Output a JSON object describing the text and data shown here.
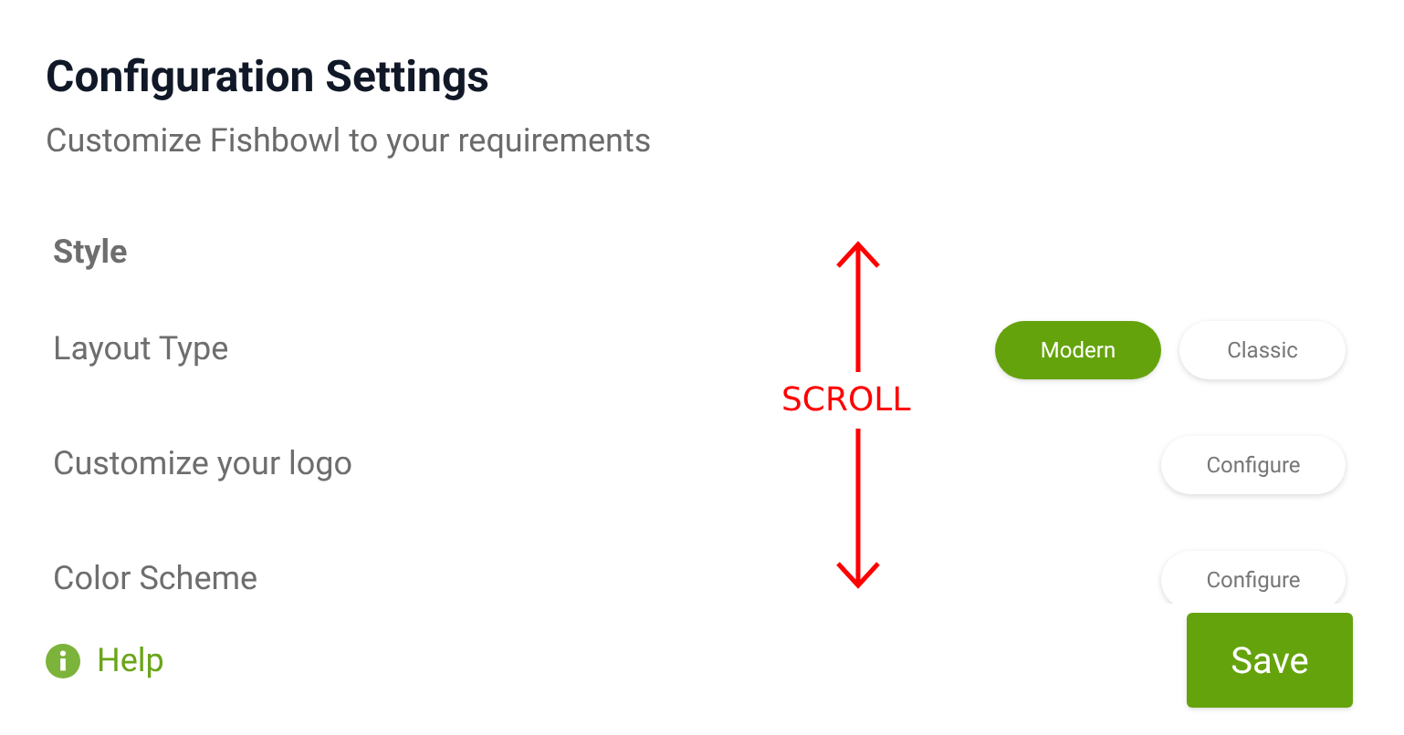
{
  "header": {
    "title": "Configuration Settings",
    "subtitle": "Customize Fishbowl to your requirements"
  },
  "section": {
    "title": "Style",
    "rows": [
      {
        "kind": "choice",
        "label": "Layout Type",
        "options": [
          {
            "label": "Modern",
            "selected": true
          },
          {
            "label": "Classic",
            "selected": false
          }
        ]
      },
      {
        "kind": "action",
        "label": "Customize your logo",
        "button": "Configure"
      },
      {
        "kind": "action",
        "label": "Color Scheme",
        "button": "Configure"
      }
    ]
  },
  "footer": {
    "help": "Help",
    "save": "Save"
  },
  "annotation": {
    "text": "SCROLL"
  }
}
